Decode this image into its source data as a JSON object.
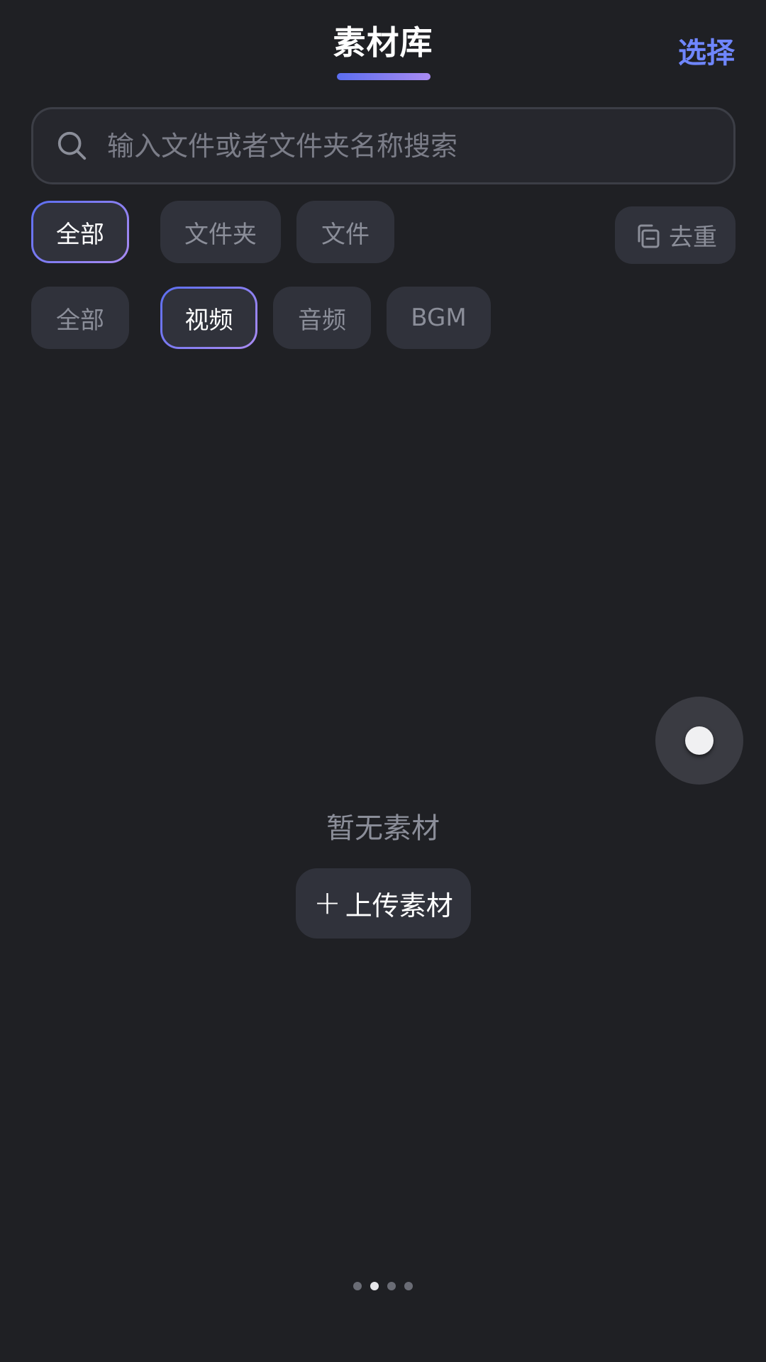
{
  "header": {
    "title": "素材库",
    "select_label": "选择"
  },
  "search": {
    "placeholder": "输入文件或者文件夹名称搜索",
    "value": ""
  },
  "scope_filters": [
    {
      "label": "全部",
      "active": true
    },
    {
      "label": "文件夹",
      "active": false
    },
    {
      "label": "文件",
      "active": false
    }
  ],
  "dedupe": {
    "label": "去重",
    "icon": "copy-minus-icon"
  },
  "type_filters": [
    {
      "label": "全部",
      "active": false
    },
    {
      "label": "视频",
      "active": true
    },
    {
      "label": "音频",
      "active": false
    },
    {
      "label": "BGM",
      "active": false
    }
  ],
  "empty_state": {
    "message": "暂无素材",
    "upload_label": "上传素材"
  },
  "page_indicator": {
    "count": 4,
    "active_index": 1
  },
  "colors": {
    "background": "#1f2024",
    "accent": "#6f86ff",
    "gradient_start": "#5b6ef0",
    "gradient_end": "#a98bf2",
    "chip_bg": "#30323b"
  }
}
